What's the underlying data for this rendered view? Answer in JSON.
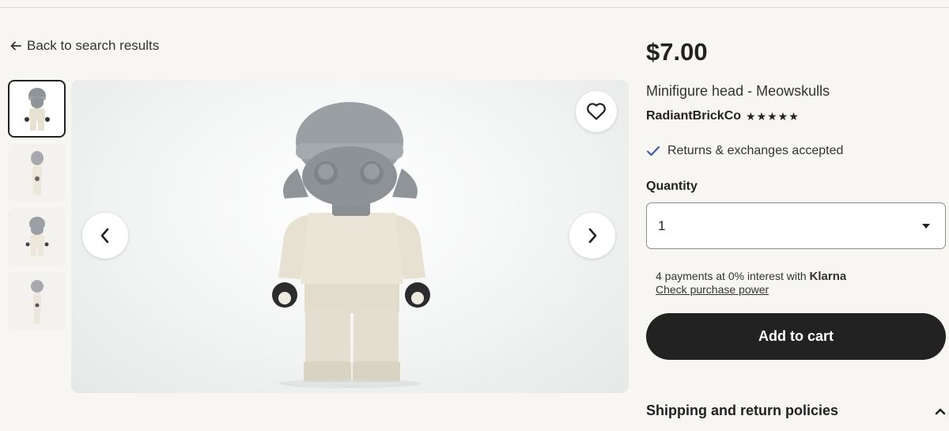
{
  "nav": {
    "back_label": "Back to search results"
  },
  "gallery": {
    "thumbnails": [
      {
        "label": "thumbnail-1",
        "selected": true
      },
      {
        "label": "thumbnail-2",
        "selected": false
      },
      {
        "label": "thumbnail-3",
        "selected": false
      },
      {
        "label": "thumbnail-4",
        "selected": false
      }
    ],
    "icons": {
      "favorite": "heart-icon",
      "prev": "chevron-left-icon",
      "next": "chevron-right-icon"
    }
  },
  "listing": {
    "price": "$7.00",
    "title": "Minifigure head - Meowskulls",
    "shop_name": "RadiantBrickCo",
    "rating_stars": "★★★★★",
    "returns_text": "Returns & exchanges accepted"
  },
  "quantity": {
    "label": "Quantity",
    "value": "1"
  },
  "klarna": {
    "text": "4 payments at 0% interest with",
    "brand": "Klarna",
    "link": "Check purchase power"
  },
  "actions": {
    "add_to_cart": "Add to cart"
  },
  "shipping": {
    "label": "Shipping and return policies"
  },
  "colors": {
    "background": "#f7f6f2",
    "dark": "#222222",
    "check": "#3b5ea6",
    "figure_head": "#8f9499",
    "figure_body": "#e7e1d2"
  }
}
